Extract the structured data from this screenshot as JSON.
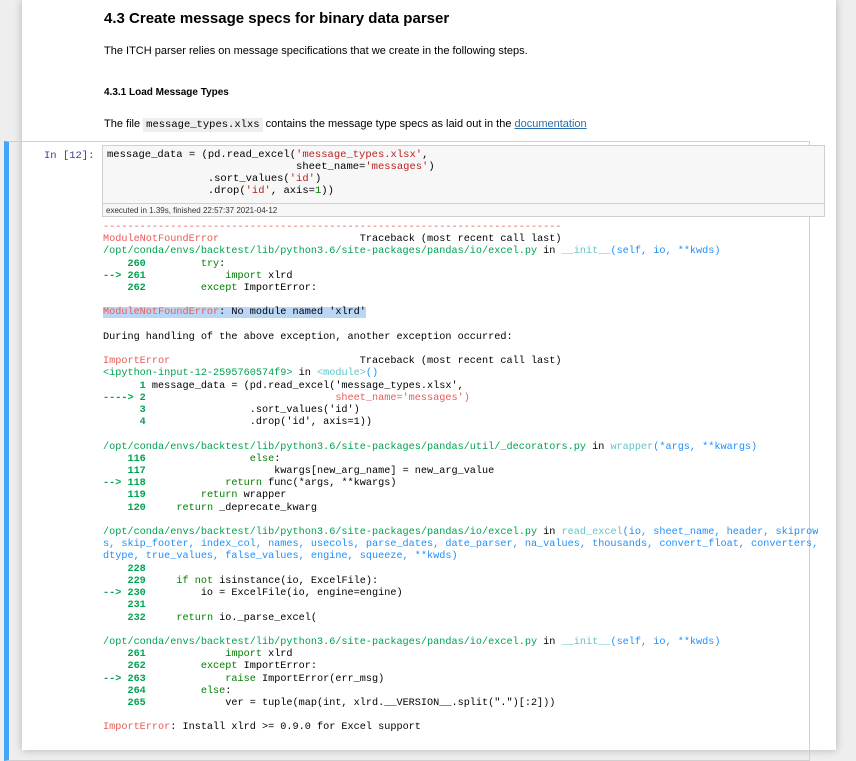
{
  "section": {
    "heading": "4.3  Create message specs for binary data parser",
    "intro": "The ITCH parser relies on message specifications that we create in the following steps.",
    "subheading": "4.3.1  Load Message Types",
    "file_text_before": "The file ",
    "file_name": "message_types.xlxs",
    "file_text_after": " contains the message type specs as laid out in the ",
    "link_text": "documentation"
  },
  "cell": {
    "prompt": "In [12]:",
    "exec_info": "executed in 1.39s, finished 22:57:37 2021-04-12"
  },
  "colors": {
    "cell_border": "#42a5f5",
    "error": "#e75c58",
    "path": "#00a250",
    "link": "#296eaa"
  }
}
